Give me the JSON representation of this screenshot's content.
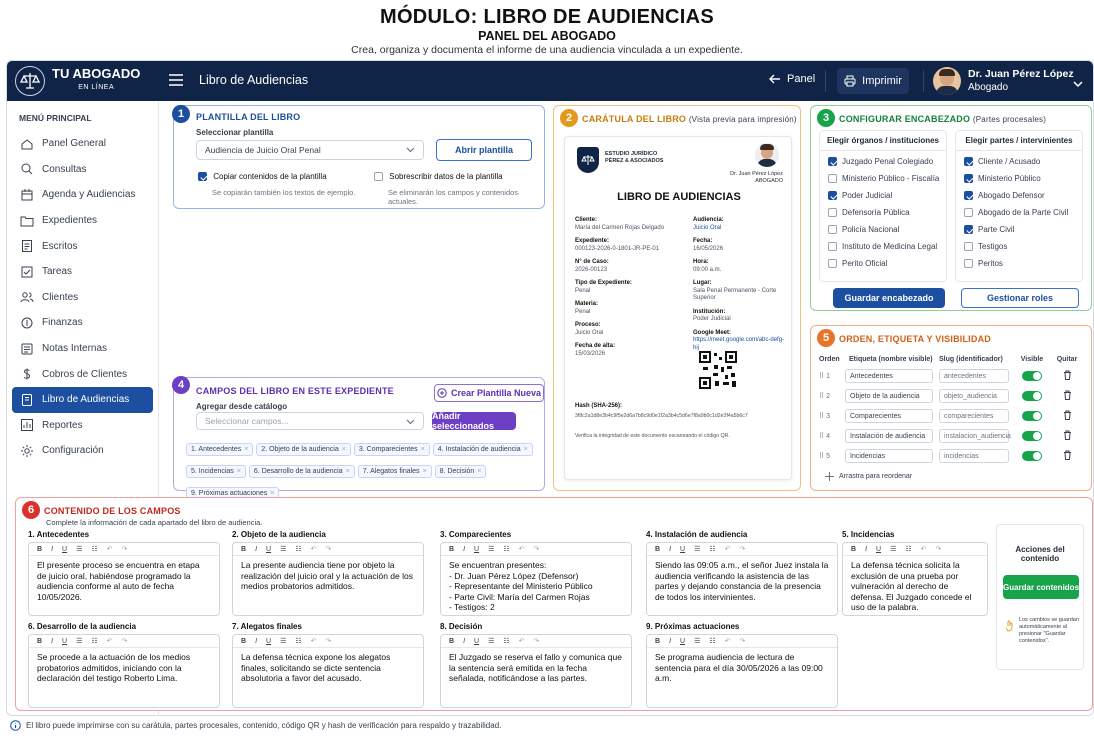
{
  "header": {
    "title": "MÓDULO: LIBRO DE AUDIENCIAS",
    "subtitle": "PANEL DEL ABOGADO",
    "description": "Crea, organiza y documenta el informe de una audiencia vinculada a un expediente."
  },
  "topbar": {
    "brand": "TU ABOGADO",
    "brand_sub": "EN LÍNEA",
    "page_title": "Libro de Audiencias",
    "back_label": "Panel",
    "print_label": "Imprimir",
    "user_name": "Dr. Juan Pérez López",
    "user_role": "Abogado"
  },
  "sidebar": {
    "heading": "MENÚ PRINCIPAL",
    "items": [
      {
        "label": "Panel General",
        "icon": "home-icon"
      },
      {
        "label": "Consultas",
        "icon": "search-icon"
      },
      {
        "label": "Agenda y Audiencias",
        "icon": "calendar-icon"
      },
      {
        "label": "Expedientes",
        "icon": "folder-icon"
      },
      {
        "label": "Escritos",
        "icon": "document-icon"
      },
      {
        "label": "Tareas",
        "icon": "checklist-icon"
      },
      {
        "label": "Clientes",
        "icon": "users-icon"
      },
      {
        "label": "Finanzas",
        "icon": "coin-icon"
      },
      {
        "label": "Notas Internas",
        "icon": "note-icon"
      },
      {
        "label": "Cobros de Clientes",
        "icon": "dollar-icon"
      },
      {
        "label": "Libro de Audiencias",
        "icon": "book-icon",
        "active": true
      },
      {
        "label": "Reportes",
        "icon": "chart-icon"
      },
      {
        "label": "Configuración",
        "icon": "gear-icon"
      }
    ]
  },
  "plantilla": {
    "number": "1",
    "title": "PLANTILLA DEL LIBRO",
    "select_label": "Seleccionar plantilla",
    "selected": "Audiencia de Juicio Oral Penal",
    "open_button": "Abrir plantilla",
    "copy_label": "Copiar contenidos de la plantilla",
    "copy_hint": "Se copiarán también los textos de ejemplo.",
    "overwrite_label": "Sobrescribir datos de la plantilla",
    "overwrite_hint": "Se eliminarán los campos y contenidos actuales."
  },
  "caratula": {
    "number": "2",
    "title": "CARÁTULA DEL LIBRO",
    "title_note": "(Vista previa para impresión)",
    "firm": "ESTUDIO JURÍDICO\nPÉREZ & ASOCIADOS",
    "lawyer": "Dr. Juan Pérez López",
    "lawyer_role": "ABOGADO",
    "doc_title": "LIBRO DE AUDIENCIAS",
    "left": [
      {
        "k": "Cliente:",
        "v": "María del Carmen Rojas Delgado"
      },
      {
        "k": "Expediente:",
        "v": "000123-2026-0-1801-JR-PE-01"
      },
      {
        "k": "N° de Caso:",
        "v": "2026-00123"
      },
      {
        "k": "Tipo de Expediente:",
        "v": "Penal"
      },
      {
        "k": "Materia:",
        "v": "Penal"
      },
      {
        "k": "Proceso:",
        "v": "Juicio Oral"
      },
      {
        "k": "Fecha de alta:",
        "v": "15/03/2026"
      }
    ],
    "right": [
      {
        "k": "Audiencia:",
        "v": "Juicio Oral"
      },
      {
        "k": "Fecha:",
        "v": "16/05/2026"
      },
      {
        "k": "Hora:",
        "v": "09:00 a.m."
      },
      {
        "k": "Lugar:",
        "v": "Sala Penal Permanente - Corte Superior"
      },
      {
        "k": "Institución:",
        "v": "Poder Judicial"
      },
      {
        "k": "Google Meet:",
        "v": "https://meet.google.com/abc-defg-hij"
      }
    ],
    "hash_label": "Hash (SHA-256):",
    "hash": "3f8c2a1d8e3b4c9f5e2d6a7b8c9d0e1f2a3b4c5d6e7f8a9b0c1d2e3f4a5b6c7",
    "verify": "Verifica la integridad de este documento escaneando el código QR."
  },
  "encabezado": {
    "number": "3",
    "title": "CONFIGURAR ENCABEZADO",
    "title_note": "(Partes procesales)",
    "col1_title": "Elegir órganos / instituciones",
    "col2_title": "Elegir partes / intervinientes",
    "col1": [
      {
        "label": "Juzgado Penal Colegiado",
        "checked": true
      },
      {
        "label": "Ministerio Público - Fiscalía",
        "checked": false
      },
      {
        "label": "Poder Judicial",
        "checked": true
      },
      {
        "label": "Defensoría Pública",
        "checked": false
      },
      {
        "label": "Policía Nacional",
        "checked": false
      },
      {
        "label": "Instituto de Medicina Legal",
        "checked": false
      },
      {
        "label": "Perito Oficial",
        "checked": false
      }
    ],
    "col2": [
      {
        "label": "Cliente / Acusado",
        "checked": true
      },
      {
        "label": "Ministerio Público",
        "checked": true
      },
      {
        "label": "Abogado Defensor",
        "checked": true
      },
      {
        "label": "Abogado de la Parte Civil",
        "checked": false
      },
      {
        "label": "Parte Civil",
        "checked": true
      },
      {
        "label": "Testigos",
        "checked": false
      },
      {
        "label": "Peritos",
        "checked": false
      }
    ],
    "save_button": "Guardar encabezado",
    "roles_button": "Gestionar roles"
  },
  "campos": {
    "number": "4",
    "title": "CAMPOS DEL LIBRO EN ESTE EXPEDIENTE",
    "create_button": "Crear Plantilla Nueva",
    "catalog_label": "Agregar desde catálogo",
    "catalog_placeholder": "Seleccionar campos...",
    "add_button": "Añadir seleccionados",
    "chips": [
      "1. Antecedentes",
      "2. Objeto de la audiencia",
      "3. Comparecientes",
      "4. Instalación de audiencia",
      "5. Incidencias",
      "6. Desarrollo de la audiencia",
      "7. Alegatos finales",
      "8. Decisión",
      "9. Próximas actuaciones"
    ]
  },
  "orden": {
    "number": "5",
    "title": "ORDEN, ETIQUETA Y VISIBILIDAD",
    "headers": [
      "Orden",
      "Etiqueta (nombre visible)",
      "Slug (identificador)",
      "Visible",
      "Quitar"
    ],
    "rows": [
      {
        "n": "1",
        "label": "Antecedentes",
        "slug": "antecedentes"
      },
      {
        "n": "2",
        "label": "Objeto de la audiencia",
        "slug": "objeto_audiencia"
      },
      {
        "n": "3",
        "label": "Comparecientes",
        "slug": "comparecientes"
      },
      {
        "n": "4",
        "label": "Instalación de audiencia",
        "slug": "instalacion_audiencia"
      },
      {
        "n": "5",
        "label": "Incidencias",
        "slug": "incidencias"
      }
    ],
    "drag_hint": "Arrastra para reordenar"
  },
  "contenido": {
    "number": "6",
    "title": "CONTENIDO DE LOS CAMPOS",
    "subtitle": "Complete la información de cada apartado del libro de audiencia.",
    "toolbar": [
      "B",
      "I",
      "U",
      "☰",
      "☷",
      "↶",
      "↷",
      "⟲",
      "⟳"
    ],
    "fields": [
      {
        "title": "1. Antecedentes",
        "text": "El presente proceso se encuentra en etapa de juicio oral, habiéndose programado la audiencia conforme al auto de fecha 10/05/2026."
      },
      {
        "title": "2. Objeto de la audiencia",
        "text": "La presente audiencia tiene por objeto la realización del juicio oral y la actuación de los medios probatorios admitidos."
      },
      {
        "title": "3. Comparecientes",
        "text": "Se encuentran presentes:\n- Dr. Juan Pérez López (Defensor)\n- Representante del Ministerio Público\n- Parte Civil: María del Carmen Rojas\n- Testigos: 2"
      },
      {
        "title": "4. Instalación de audiencia",
        "text": "Siendo las 09:05 a.m., el señor Juez instala la audiencia verificando la asistencia de las partes y dejando constancia de la presencia de todos los intervinientes."
      },
      {
        "title": "5. Incidencias",
        "text": "La defensa técnica solicita la exclusión de una prueba por vulneración al derecho de defensa. El Juzgado concede el uso de la palabra."
      },
      {
        "title": "6. Desarrollo de la audiencia",
        "text": "Se procede a la actuación de los medios probatorios admitidos, iniciando con la declaración del testigo Roberto Lima."
      },
      {
        "title": "7. Alegatos finales",
        "text": "La defensa técnica expone los alegatos finales, solicitando se dicte sentencia absolutoria a favor del acusado."
      },
      {
        "title": "8. Decisión",
        "text": "El Juzgado se reserva el fallo y comunica que la sentencia será emitida en la fecha señalada, notificándose a las partes."
      },
      {
        "title": "9. Próximas actuaciones",
        "text": "Se programa audiencia de lectura de sentencia para el día 30/05/2026 a las 09:00 a.m."
      }
    ],
    "actions_title": "Acciones del contenido",
    "save_button": "Guardar contenidos",
    "autosave_note": "Los cambios se guardan automáticamente al presionar \"Guardar contenidos\"."
  },
  "footer": {
    "note": "El libro puede imprimirse con su carátula, partes procesales, contenido, código QR y hash de verificación para respaldo y trazabilidad."
  },
  "colors": {
    "navy": "#0f2446",
    "blue": "#1d4fa0",
    "gold": "#e39a1b",
    "green": "#16a34a",
    "purple": "#6d3fc4",
    "orange": "#e8742a",
    "red": "#d9342b"
  }
}
